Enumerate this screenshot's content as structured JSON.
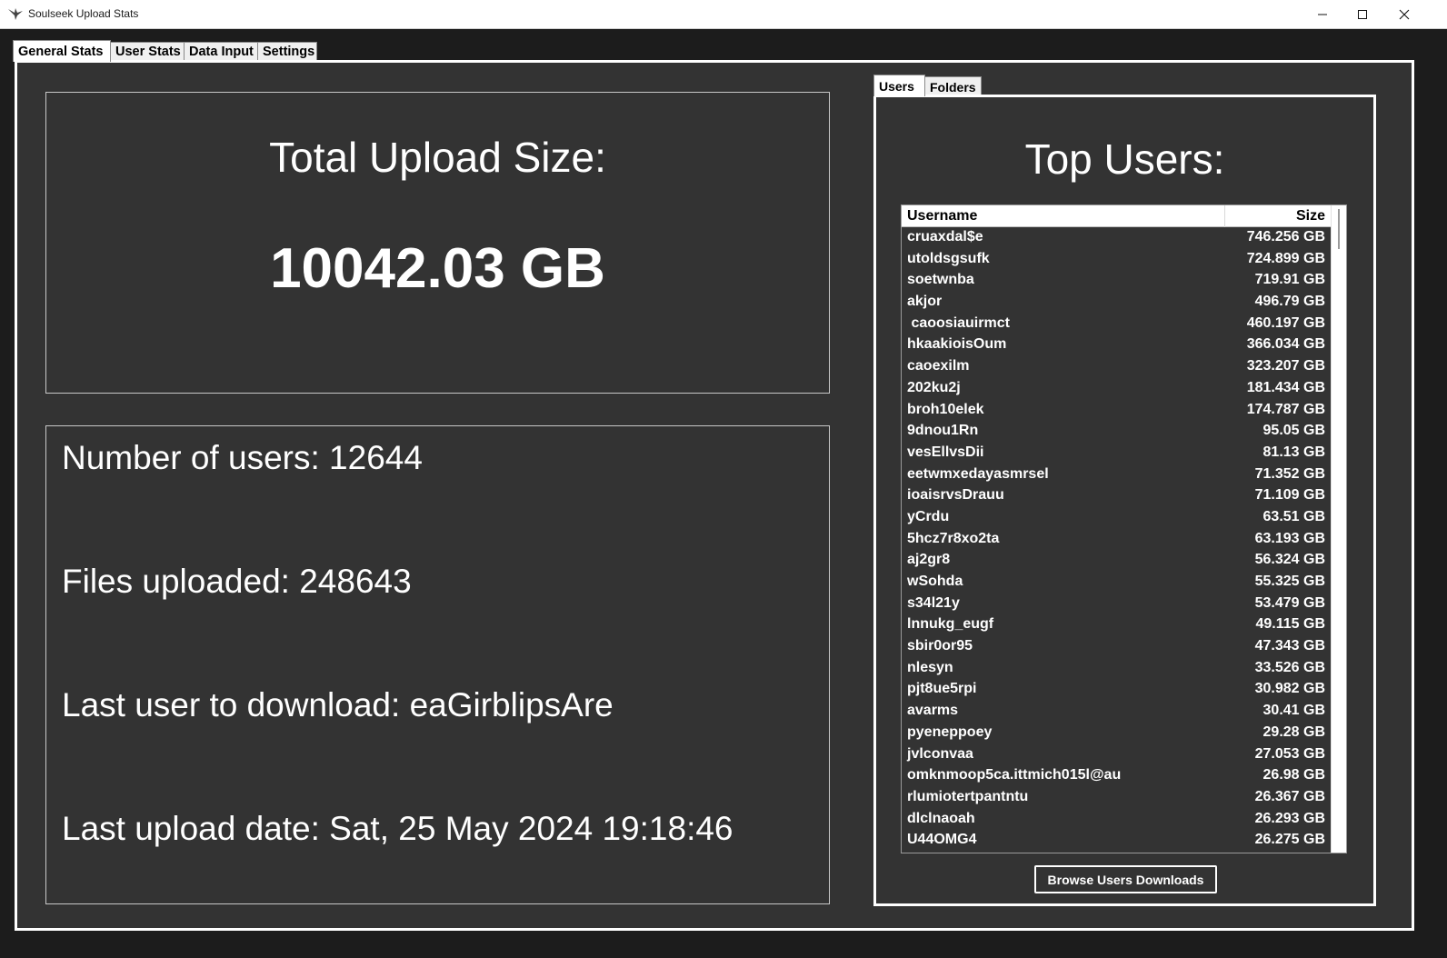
{
  "window": {
    "title": "Soulseek Upload Stats",
    "icons": {
      "app": "soulseek-bird-icon",
      "minimize": "minimize-icon",
      "maximize": "maximize-icon",
      "close": "close-icon"
    }
  },
  "main_tabs": [
    {
      "label": "General Stats",
      "active": true
    },
    {
      "label": "User Stats",
      "active": false
    },
    {
      "label": "Data Input",
      "active": false
    },
    {
      "label": "Settings",
      "active": false
    }
  ],
  "total_upload": {
    "heading": "Total Upload Size:",
    "value": "10042.03 GB"
  },
  "stats": {
    "users": "Number of users: 12644",
    "files": "Files uploaded: 248643",
    "last_user": "Last user to download: eaGirblipsAre",
    "last_date": "Last upload date: Sat, 25 May 2024 19:18:46"
  },
  "right_tabs": [
    {
      "label": "Users",
      "active": true
    },
    {
      "label": "Folders",
      "active": false
    }
  ],
  "top_users": {
    "heading": "Top Users:",
    "columns": {
      "username": "Username",
      "size": "Size"
    },
    "rows": [
      {
        "user": "cruaxdal$e",
        "size": "746.256 GB"
      },
      {
        "user": "utoldsgsufk",
        "size": "724.899 GB"
      },
      {
        "user": "soetwnba",
        "size": "719.91 GB"
      },
      {
        "user": "akjor",
        "size": "496.79 GB"
      },
      {
        "user": " caoosiauirmct",
        "size": "460.197 GB"
      },
      {
        "user": "hkaakioisOum",
        "size": "366.034 GB"
      },
      {
        "user": "caoexilm",
        "size": "323.207 GB"
      },
      {
        "user": "202ku2j",
        "size": "181.434 GB"
      },
      {
        "user": "broh10elek",
        "size": "174.787 GB"
      },
      {
        "user": "9dnou1Rn",
        "size": "95.05 GB"
      },
      {
        "user": "vesEllvsDii",
        "size": "81.13 GB"
      },
      {
        "user": "eetwmxedayasmrsel",
        "size": "71.352 GB"
      },
      {
        "user": "ioaisrvsDrauu",
        "size": "71.109 GB"
      },
      {
        "user": "yCrdu",
        "size": "63.51 GB"
      },
      {
        "user": "5hcz7r8xo2ta",
        "size": "63.193 GB"
      },
      {
        "user": "aj2gr8",
        "size": "56.324 GB"
      },
      {
        "user": "wSohda",
        "size": "55.325 GB"
      },
      {
        "user": "s34l21y",
        "size": "53.479 GB"
      },
      {
        "user": "lnnukg_eugf",
        "size": "49.115 GB"
      },
      {
        "user": "sbir0or95",
        "size": "47.343 GB"
      },
      {
        "user": "nlesyn",
        "size": "33.526 GB"
      },
      {
        "user": "pjt8ue5rpi",
        "size": "30.982 GB"
      },
      {
        "user": "avarms",
        "size": "30.41 GB"
      },
      {
        "user": "pyeneppoey",
        "size": "29.28 GB"
      },
      {
        "user": "jvlconvaa",
        "size": "27.053 GB"
      },
      {
        "user": "omknmoop5ca.ittmich015l@au",
        "size": "26.98 GB"
      },
      {
        "user": "rlumiotertpantntu",
        "size": "26.367 GB"
      },
      {
        "user": "dlclnaoah",
        "size": "26.293 GB"
      },
      {
        "user": "U44OMG4",
        "size": "26.275 GB"
      }
    ],
    "browse_button": "Browse Users Downloads"
  }
}
